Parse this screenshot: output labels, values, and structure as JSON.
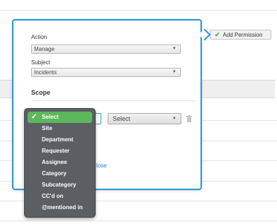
{
  "toolbar": {
    "add_permission_label": "Add Permission"
  },
  "permission_form": {
    "action_label": "Action",
    "action_value": "Manage",
    "subject_label": "Subject",
    "subject_value": "Incidents",
    "scope_title": "Scope",
    "scope_value_select": "Select",
    "close_link": "lose"
  },
  "scope_dropdown": {
    "options": [
      "Select",
      "Site",
      "Department",
      "Requester",
      "Assignee",
      "Category",
      "Subcategory",
      "CC'd on",
      "@mentioned in"
    ],
    "selected": "Select"
  },
  "colors": {
    "accent": "#2b94d3",
    "selected_option": "#5cb85c",
    "dropdown_bg": "#5b5f63"
  }
}
